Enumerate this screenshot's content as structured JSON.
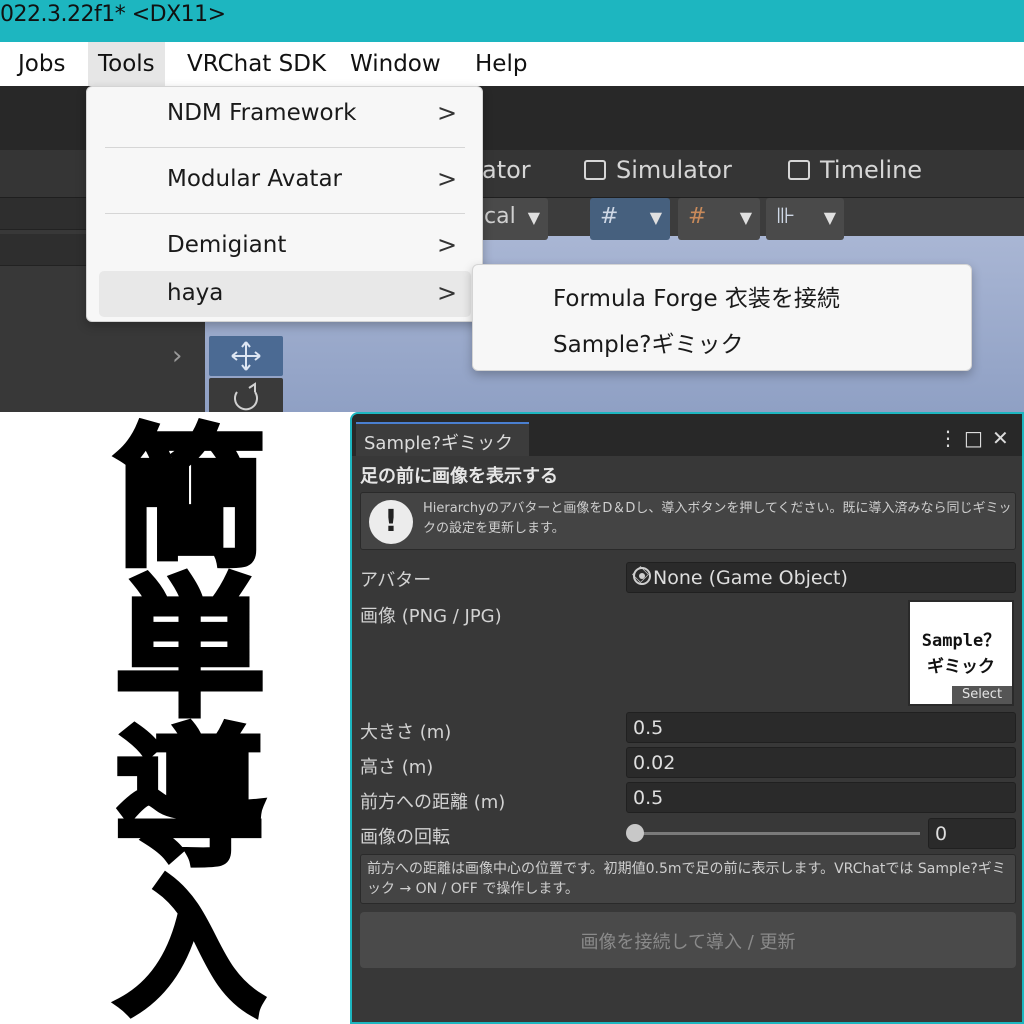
{
  "window": {
    "title": "022.3.22f1* <DX11>"
  },
  "menubar": {
    "items": [
      {
        "label": "Jobs"
      },
      {
        "label": "Tools"
      },
      {
        "label": "VRChat SDK"
      },
      {
        "label": "Window"
      },
      {
        "label": "Help"
      }
    ]
  },
  "tools_menu": {
    "items": [
      {
        "label": "NDM Framework",
        "arrow": ">"
      },
      {
        "label": "Modular Avatar",
        "arrow": ">"
      },
      {
        "label": "Demigiant",
        "arrow": ">"
      },
      {
        "label": "haya",
        "arrow": ">"
      }
    ]
  },
  "haya_submenu": {
    "items": [
      {
        "label": "Formula Forge 衣装を接続"
      },
      {
        "label": "Sample?ギミック"
      }
    ]
  },
  "editor": {
    "tabs": [
      {
        "label": "ator"
      },
      {
        "label": "Simulator",
        "icon": "simulator-icon"
      },
      {
        "label": "Timeline",
        "icon": "timeline-icon"
      }
    ],
    "toolbar_partial": "cal"
  },
  "big_title": {
    "chars": [
      "簡",
      "単",
      "導",
      "入"
    ]
  },
  "inspector": {
    "tab_title": "Sample?ギミック",
    "section_title": "足の前に画像を表示する",
    "help_text": "Hierarchyのアバターと画像をD＆Dし、導入ボタンを押してください。既に導入済みなら同じギミックの設定を更新します。",
    "avatar": {
      "label": "アバター",
      "value": "None (Game Object)"
    },
    "image": {
      "label": "画像 (PNG / JPG)",
      "thumb_text": "Sample？\nギミック",
      "select_label": "Select"
    },
    "size": {
      "label": "大きさ (m)",
      "value": "0.5"
    },
    "height": {
      "label": "高さ (m)",
      "value": "0.02"
    },
    "distance": {
      "label": "前方への距離 (m)",
      "value": "0.5"
    },
    "rotation": {
      "label": "画像の回転",
      "value": "0",
      "fraction": 0
    },
    "note": "前方への距離は画像中心の位置です。初期値0.5mで足の前に表示します。VRChatでは Sample?ギミック → ON / OFF で操作します。",
    "apply_button": "画像を接続して導入 / 更新"
  }
}
